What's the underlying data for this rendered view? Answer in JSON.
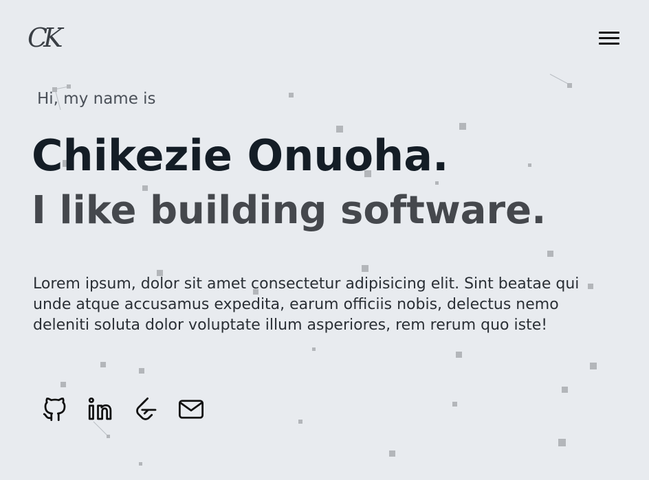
{
  "header": {
    "logo_text": "CK",
    "menu_icon": "hamburger-menu-icon"
  },
  "hero": {
    "greeting": "Hi, my name is",
    "name": "Chikezie Onuoha.",
    "tagline": "I like building software.",
    "bio": "Lorem ipsum, dolor sit amet consectetur adipisicing elit. Sint beatae qui unde atque accusamus expedita, earum officiis nobis, delectus nemo deleniti soluta dolor voluptate illum asperiores, rem rerum quo iste!"
  },
  "socials": [
    {
      "icon": "github-icon"
    },
    {
      "icon": "linkedin-icon"
    },
    {
      "icon": "leetcode-icon"
    },
    {
      "icon": "email-icon"
    }
  ],
  "colors": {
    "background": "#e8ebef",
    "name": "#141d26",
    "tagline": "#45484d",
    "particle": "#b3b6ba"
  }
}
